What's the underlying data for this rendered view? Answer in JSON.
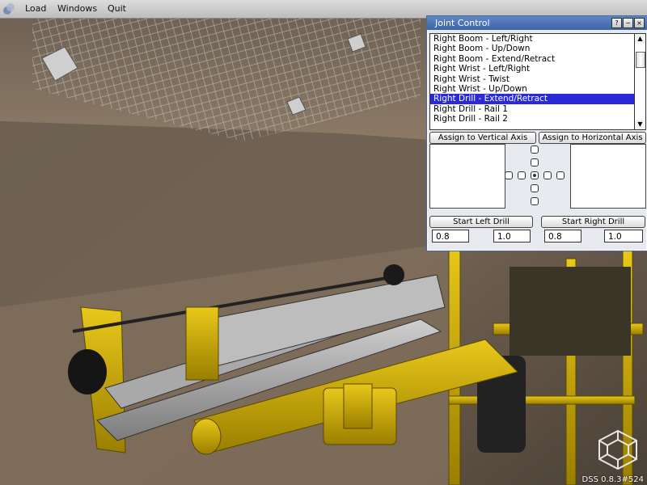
{
  "menubar": {
    "items": [
      "Load",
      "Windows",
      "Quit"
    ]
  },
  "joint_control": {
    "title": "Joint Control",
    "title_buttons": [
      "?",
      "−",
      "×"
    ],
    "joints": [
      "Right Boom - Left/Right",
      "Right Boom - Up/Down",
      "Right Boom - Extend/Retract",
      "Right Wrist - Left/Right",
      "Right Wrist - Twist",
      "Right Wrist - Up/Down",
      "Right Drill - Extend/Retract",
      "Right Drill - Rail 1",
      "Right Drill - Rail 2"
    ],
    "selected_index": 6,
    "assign_vertical": "Assign to Vertical Axis",
    "assign_horizontal": "Assign to Horizontal Axis",
    "start_left": "Start Left Drill",
    "start_right": "Start Right Drill",
    "left_values": [
      "0.8",
      "1.0"
    ],
    "right_values": [
      "0.8",
      "1.0"
    ]
  },
  "status": {
    "version": "DSS 0.8.3#524"
  },
  "colors": {
    "selection": "#2a2ad8",
    "titlebar": "#4a70b0",
    "machine_yellow": "#d4b000"
  }
}
